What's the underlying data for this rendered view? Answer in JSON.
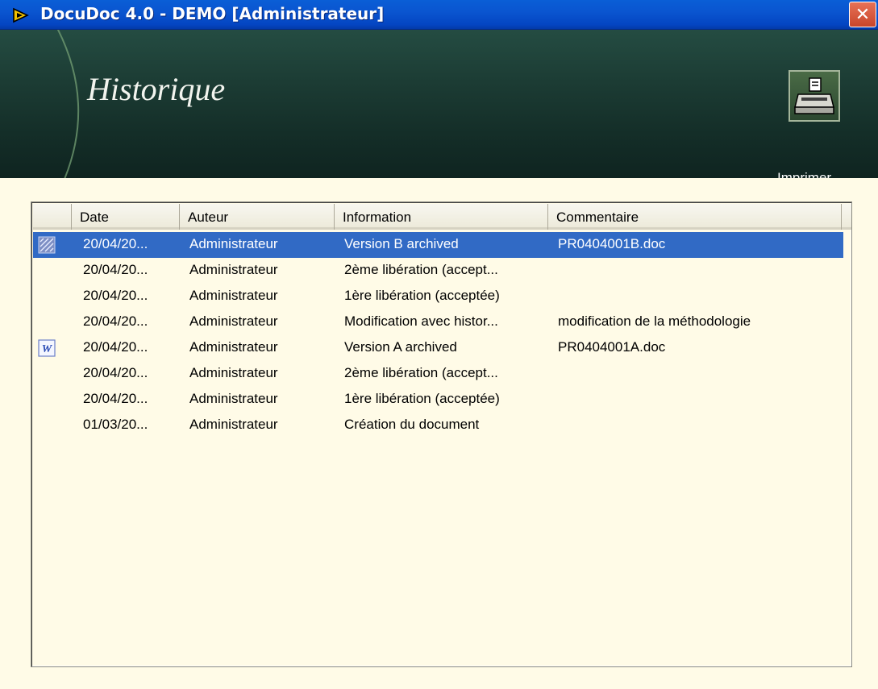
{
  "window": {
    "title": "DocuDoc 4.0 - DEMO [Administrateur]",
    "close_symbol": "✕"
  },
  "banner": {
    "heading": "Historique"
  },
  "toolbar": {
    "print_label": "Imprimer",
    "print_accel": "I",
    "print_rest": "mprimer"
  },
  "table": {
    "columns": [
      "Date",
      "Auteur",
      "Information",
      "Commentaire"
    ],
    "rows": [
      {
        "icon": "archive-icon",
        "date": "20/04/20...",
        "auteur": "Administrateur",
        "information": "Version B archived",
        "commentaire": "PR0404001B.doc",
        "selected": true
      },
      {
        "icon": "",
        "date": "20/04/20...",
        "auteur": "Administrateur",
        "information": "2ème libération (accept...",
        "commentaire": ""
      },
      {
        "icon": "",
        "date": "20/04/20...",
        "auteur": "Administrateur",
        "information": "1ère libération (acceptée)",
        "commentaire": ""
      },
      {
        "icon": "",
        "date": "20/04/20...",
        "auteur": "Administrateur",
        "information": "Modification avec histor...",
        "commentaire": "modification de la méthodologie"
      },
      {
        "icon": "word-document-icon",
        "date": "20/04/20...",
        "auteur": "Administrateur",
        "information": "Version A archived",
        "commentaire": "PR0404001A.doc"
      },
      {
        "icon": "",
        "date": "20/04/20...",
        "auteur": "Administrateur",
        "information": "2ème libération (accept...",
        "commentaire": ""
      },
      {
        "icon": "",
        "date": "20/04/20...",
        "auteur": "Administrateur",
        "information": "1ère libération (acceptée)",
        "commentaire": ""
      },
      {
        "icon": "",
        "date": "01/03/20...",
        "auteur": "Administrateur",
        "information": "Création du document",
        "commentaire": ""
      }
    ]
  },
  "colors": {
    "selection": "#316ac5",
    "background": "#fffbe7",
    "titlebar": "#0a55d0",
    "banner": "#1c3c34"
  }
}
